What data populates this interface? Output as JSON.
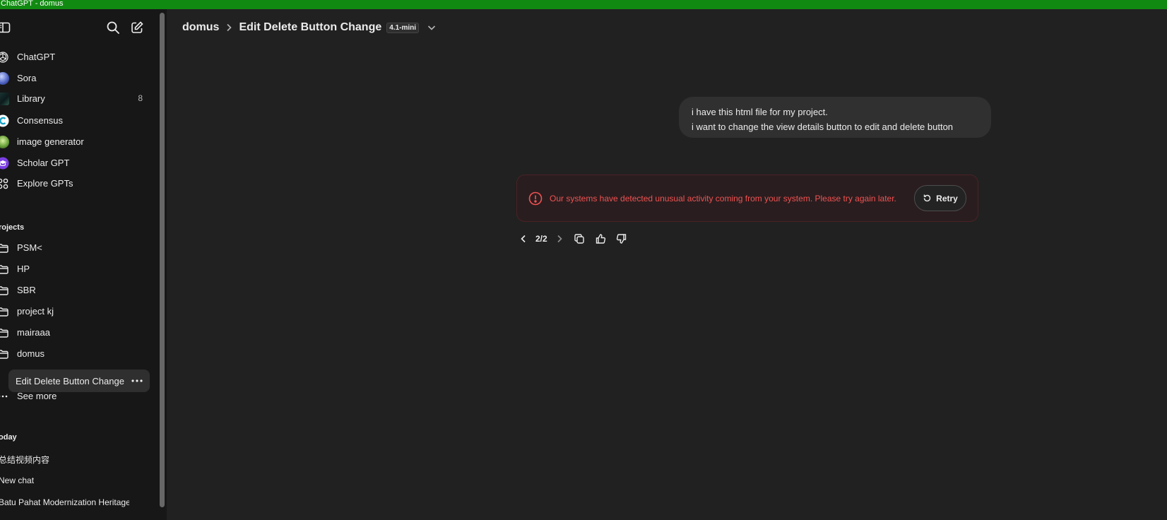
{
  "window": {
    "title": "ChatGPT - domus"
  },
  "sidebar": {
    "nav": [
      {
        "label": "ChatGPT",
        "icon": "chatgpt-logo-icon"
      },
      {
        "label": "Sora",
        "icon": "sora-avatar"
      },
      {
        "label": "Library",
        "icon": "library-thumbnail",
        "count": "8"
      },
      {
        "label": "Consensus",
        "icon": "consensus-avatar"
      },
      {
        "label": "image generator",
        "icon": "image-generator-avatar"
      },
      {
        "label": "Scholar GPT",
        "icon": "scholar-gpt-avatar"
      },
      {
        "label": "Explore GPTs",
        "icon": "grid-icon"
      }
    ],
    "projects_label": "rojects",
    "projects": [
      {
        "label": "PSM<"
      },
      {
        "label": "HP"
      },
      {
        "label": "SBR"
      },
      {
        "label": "project kj"
      },
      {
        "label": "mairaaa"
      },
      {
        "label": "domus"
      }
    ],
    "active_chat": "Edit Delete Button Change",
    "see_more": "See more",
    "today_label": "oday",
    "chats": [
      {
        "label": "总结视频内容"
      },
      {
        "label": "New chat"
      },
      {
        "label": "Batu Pahat Modernization Heritage"
      }
    ]
  },
  "header": {
    "project": "domus",
    "title": "Edit Delete Button Change",
    "model": "4.1-mini"
  },
  "conversation": {
    "user_message_lines": [
      "i have this html file for my project.",
      "i want to change the view details button to edit and delete button"
    ],
    "error_text": "Our systems have detected unusual activity coming from your system. Please try again later.",
    "retry_label": "Retry",
    "pager": "2/2"
  },
  "colors": {
    "titlebar": "#118a11",
    "background": "#212121",
    "sidebar": "#171717",
    "error": "#f05252"
  }
}
